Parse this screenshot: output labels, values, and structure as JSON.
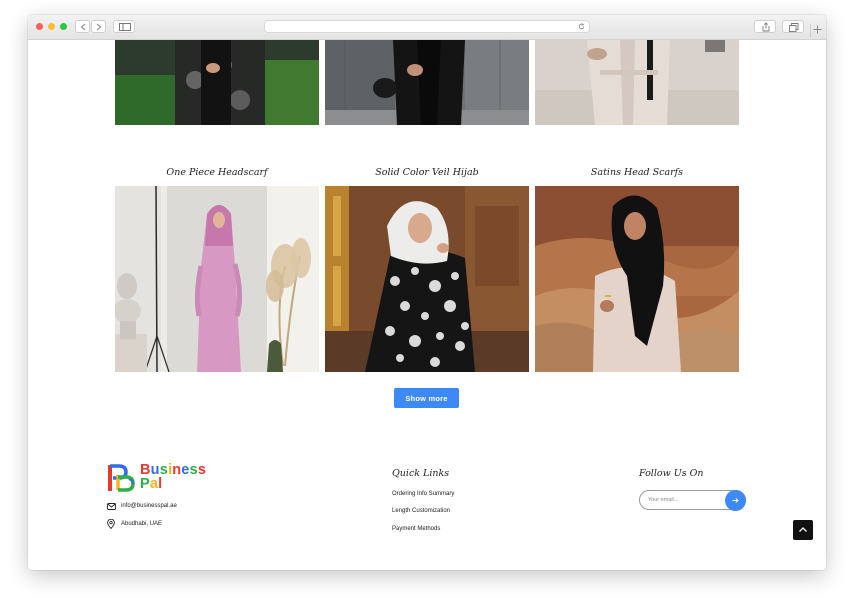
{
  "browser": {
    "url": ""
  },
  "top_products": [
    {
      "image": "abaya-floral-print-photo"
    },
    {
      "image": "black-leather-jacket-photo"
    },
    {
      "image": "beige-trench-abaya-photo"
    }
  ],
  "products": [
    {
      "title": "One Piece Headscarf",
      "image": "pink-hijab-dress-photo"
    },
    {
      "title": "Solid Color Veil Hijab",
      "image": "white-hijab-patterned-dress-photo"
    },
    {
      "title": "Satins Head Scarfs",
      "image": "black-satin-scarf-desert-photo"
    }
  ],
  "show_more_label": "Show more",
  "footer": {
    "brand": {
      "line1": "Business",
      "line2": "Pal",
      "mark": "PB"
    },
    "email": "info@businesspal.ae",
    "location": "Abudhabi, UAE",
    "quick_links_heading": "Quick Links",
    "quick_links": [
      "Ordering Info Summary",
      "Length Customization",
      "Payment Methods"
    ],
    "follow_heading": "Follow Us On",
    "email_placeholder": "Your email..."
  },
  "colors": {
    "accent": "#3d8af7",
    "brand_red": "#e8392f",
    "brand_green": "#2fae4a",
    "brand_blue": "#2f6fe0",
    "brand_yellow": "#f6b51c"
  }
}
